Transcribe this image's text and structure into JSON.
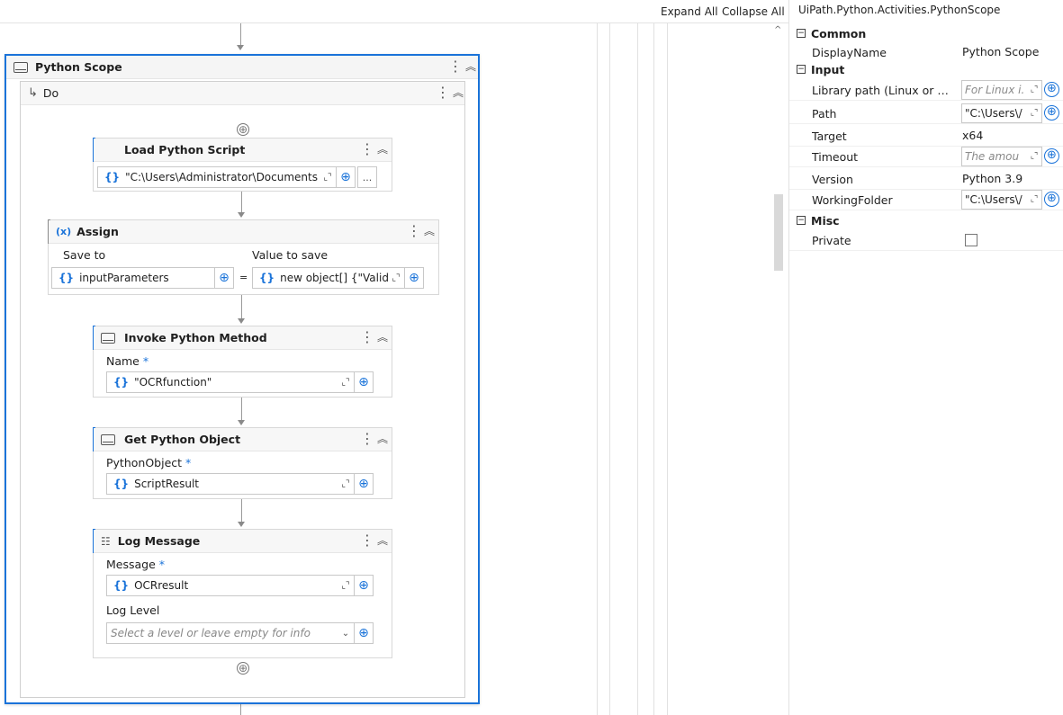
{
  "toolbar": {
    "expand_all": "Expand All",
    "collapse_all": "Collapse All"
  },
  "scope": {
    "title": "Python Scope",
    "do_label": "Do",
    "load_script": {
      "title": "Load Python Script",
      "value": "\"C:\\Users\\Administrator\\Documents",
      "ellipsis": "..."
    },
    "assign": {
      "title": "Assign",
      "save_to_label": "Save to",
      "value_to_save_label": "Value to save",
      "save_to_value": "inputParameters",
      "value_value": "new object[] {\"ValidC",
      "equals": "="
    },
    "invoke": {
      "title": "Invoke Python Method",
      "name_label": "Name",
      "name_value": "\"OCRfunction\""
    },
    "get_object": {
      "title": "Get Python Object",
      "label": "PythonObject",
      "value": "ScriptResult"
    },
    "log": {
      "title": "Log Message",
      "message_label": "Message",
      "message_value": "OCRresult",
      "level_label": "Log Level",
      "level_placeholder": "Select a level or leave empty for info"
    }
  },
  "properties": {
    "title": "UiPath.Python.Activities.PythonScope",
    "categories": {
      "common": "Common",
      "input": "Input",
      "misc": "Misc"
    },
    "rows": {
      "display_name": {
        "name": "DisplayName",
        "value": "Python Scope"
      },
      "library_path": {
        "name": "Library path (Linux or versi...",
        "value": "For Linux i."
      },
      "path": {
        "name": "Path",
        "value": "\"C:\\Users\\/"
      },
      "target": {
        "name": "Target",
        "value": "x64"
      },
      "timeout": {
        "name": "Timeout",
        "value": "The amou"
      },
      "version": {
        "name": "Version",
        "value": "Python 3.9"
      },
      "working_folder": {
        "name": "WorkingFolder",
        "value": "\"C:\\Users\\/"
      },
      "private": {
        "name": "Private"
      }
    }
  },
  "common": {
    "brace": "{}",
    "plus": "⊕",
    "expand": "⌞⌝",
    "required": "*",
    "kebab": "⋮",
    "collapse": "⌃",
    "minus_box": "−"
  }
}
